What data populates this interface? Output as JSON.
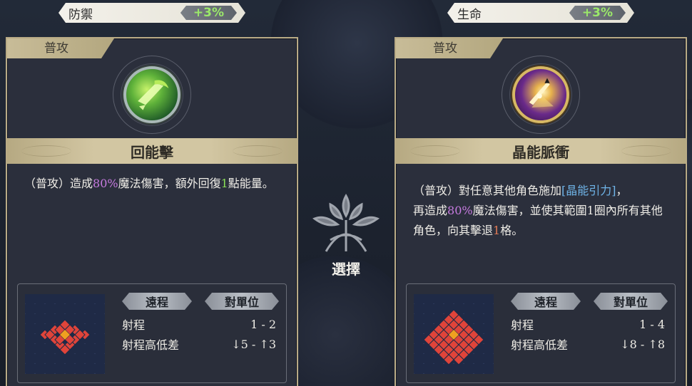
{
  "stats": {
    "left": {
      "name": "防禦",
      "value": "+3%"
    },
    "right": {
      "name": "生命",
      "value": "+3%"
    }
  },
  "select_label": "選擇",
  "cards": [
    {
      "type_label": "普攻",
      "icon": "green-energy-strike-icon",
      "title": "回能擊",
      "desc_parts": [
        "（普攻）造成",
        "80%",
        "魔法傷害，額外回復",
        "1",
        "點能量。"
      ],
      "range_tag": "遠程",
      "target_tag": "對單位",
      "range_label": "射程",
      "range_value": "1 - 2",
      "height_label": "射程高低差",
      "height_down": "5",
      "height_up": "3"
    },
    {
      "type_label": "普攻",
      "icon": "purple-crystal-pulse-icon",
      "title": "晶能脈衝",
      "desc_parts": [
        "（普攻）對任意其他角色施加",
        "[晶能引力]",
        "，",
        "再造成",
        "80%",
        "魔法傷害，並使其範圍",
        "1",
        "圈內所有其他角色，向其擊退",
        "1",
        "格。"
      ],
      "range_tag": "遠程",
      "target_tag": "對單位",
      "range_label": "射程",
      "range_value": "1 - 4",
      "height_label": "射程高低差",
      "height_down": "8",
      "height_up": "8"
    }
  ],
  "colors": {
    "accent_gold": "#b9ab86",
    "stat_green": "#9be86a",
    "hl_purple": "#c77be0",
    "hl_green": "#8ae055",
    "hl_blue": "#6fb4e8",
    "hl_red": "#e07a55",
    "range_red": "#e0443a",
    "range_center": "#f0a020"
  }
}
